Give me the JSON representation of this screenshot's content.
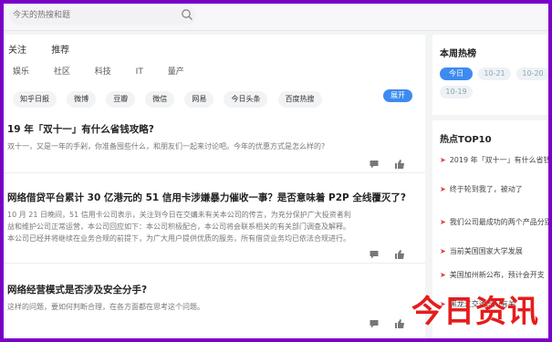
{
  "search": {
    "placeholder": "今天的热搜和题"
  },
  "tabs_primary": [
    "关注",
    "推荐"
  ],
  "tabs_secondary": [
    "娱乐",
    "社区",
    "科技",
    "IT",
    "量产"
  ],
  "channels": [
    "知乎日报",
    "微博",
    "豆瓣",
    "微信",
    "网易",
    "今日头条",
    "百度热搜"
  ],
  "channel_more": "展开",
  "articles": [
    {
      "title": "19 年「双十一」有什么省钱攻略?",
      "summary": "双十一，又是一年的手剁，你准备囤些什么，和朋友们一起来讨论吧。今年的优惠方式是怎么样的?"
    },
    {
      "title": "网络借贷平台累计 30 亿港元的 51 信用卡涉嫌暴力催收一事？是否意味着 P2P 全线覆灭了?",
      "summary": "10 月 21 日晚间，51 信用卡公司表示，关注到今日在交媾未有关本公司的传言，为充分保护广大投资者利",
      "summary2": "益和维护公司正常运营，本公司回应如下：本公司积极配合，本公司将会联系相关的有关部门调查及解释。",
      "summary3": "本公司已经并将继续在业务合规的前提下，为广大用户提供优质的服务，所有借贷业务均已依法合规进行。"
    },
    {
      "title": "网络经营模式是否涉及安全分手?",
      "summary": "这样的问题，要如何判断合理，在各方面都在思考这个问题。"
    }
  ],
  "hot_ranking": {
    "title": "本周热榜",
    "dates": [
      "今日",
      "10-21",
      "10-20",
      "10-19"
    ]
  },
  "top10": {
    "title": "热点TOP10",
    "items": [
      "2019 年「双十一」有什么省钱攻略",
      "终于轮到我了，被动了",
      "我们公司最成功的两个产品分别",
      "当前美国国家大学发展",
      "美国加州新公布，预计会开支",
      "黑龙江交通部门有关",
      "当前热点事件"
    ]
  },
  "watermark": "今日资讯",
  "colors": {
    "frame": "#7a00c8",
    "accent": "#3d8bf0",
    "watermark": "#e51d1d"
  }
}
